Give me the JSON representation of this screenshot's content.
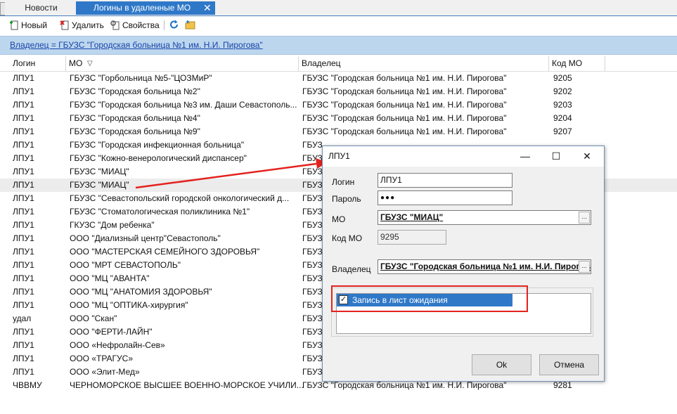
{
  "tabs": [
    {
      "label": "Новости",
      "active": false
    },
    {
      "label": "Логины в удаленные МО",
      "active": true,
      "close": "✕"
    }
  ],
  "toolbar": {
    "new_label": "Новый",
    "delete_label": "Удалить",
    "properties_label": "Свойства",
    "new_icon": "new-doc-icon",
    "delete_icon": "delete-doc-icon",
    "properties_icon": "properties-icon",
    "refresh_icon": "refresh-icon",
    "folder_icon": "folder-icon"
  },
  "filter": {
    "text": "Владелец = ГБУЗС \"Городская больница №1 им. Н.И. Пирогова\""
  },
  "grid": {
    "columns": [
      "Логин",
      "МО",
      "Владелец",
      "Код МО"
    ],
    "rows": [
      [
        "ЛПУ1",
        "ГБУЗС \"Горбольница №5-\"ЦОЗМиР\"",
        "ГБУЗС \"Городская больница №1 им. Н.И. Пирогова\"",
        "9205"
      ],
      [
        "ЛПУ1",
        "ГБУЗС \"Городская больница №2\"",
        "ГБУЗС \"Городская больница №1 им. Н.И. Пирогова\"",
        "9202"
      ],
      [
        "ЛПУ1",
        "ГБУЗС \"Городская больница №3 им. Даши Севастополь...",
        "ГБУЗС \"Городская больница №1 им. Н.И. Пирогова\"",
        "9203"
      ],
      [
        "ЛПУ1",
        "ГБУЗС \"Городская больница №4\"",
        "ГБУЗС \"Городская больница №1 им. Н.И. Пирогова\"",
        "9204"
      ],
      [
        "ЛПУ1",
        "ГБУЗС \"Городская больница №9\"",
        "ГБУЗС \"Городская больница №1 им. Н.И. Пирогова\"",
        "9207"
      ],
      [
        "ЛПУ1",
        "ГБУЗС \"Городская инфекционная больница\"",
        "ГБУЗ",
        ""
      ],
      [
        "ЛПУ1",
        "ГБУЗС \"Кожно-венерологический диспансер\"",
        "ГБУЗ",
        ""
      ],
      [
        "ЛПУ1",
        "ГБУЗС \"МИАЦ\"",
        "ГБУЗ",
        ""
      ],
      [
        "ЛПУ1",
        "ГБУЗС \"МИАЦ\"",
        "ГБУЗ",
        ""
      ],
      [
        "ЛПУ1",
        "ГБУЗС \"Севастопольский городской онкологический д...",
        "ГБУЗ",
        ""
      ],
      [
        "ЛПУ1",
        "ГБУЗС \"Стоматологическая поликлиника №1\"",
        "ГБУЗ",
        ""
      ],
      [
        "ЛПУ1",
        "ГКУЗС \"Дом ребенка\"",
        "ГБУЗ",
        ""
      ],
      [
        "ЛПУ1",
        "ООО \"Диализный центр\"Севастополь\"",
        "ГБУЗ",
        ""
      ],
      [
        "ЛПУ1",
        "ООО \"МАСТЕРСКАЯ СЕМЕЙНОГО ЗДОРОВЬЯ\"",
        "ГБУЗ",
        ""
      ],
      [
        "ЛПУ1",
        "ООО \"МРТ СЕВАСТОПОЛЬ\"",
        "ГБУЗ",
        ""
      ],
      [
        "ЛПУ1",
        "ООО \"МЦ \"АВАНТА\"",
        "ГБУЗ",
        ""
      ],
      [
        "ЛПУ1",
        "ООО \"МЦ \"АНАТОМИЯ ЗДОРОВЬЯ\"",
        "ГБУЗ",
        ""
      ],
      [
        "ЛПУ1",
        "ООО \"МЦ \"ОПТИКА-хирургия\"",
        "ГБУЗ",
        ""
      ],
      [
        "удал",
        "ООО \"Скан\"",
        "ГБУЗ",
        ""
      ],
      [
        "ЛПУ1",
        "ООО \"ФЕРТИ-ЛАЙН\"",
        "ГБУЗ",
        ""
      ],
      [
        "ЛПУ1",
        "ООО «Нефролайн-Сев»",
        "ГБУЗ",
        ""
      ],
      [
        "ЛПУ1",
        "ООО «ТРАГУС»",
        "ГБУЗ",
        ""
      ],
      [
        "ЛПУ1",
        "ООО «Элит-Мед»",
        "ГБУЗ",
        ""
      ],
      [
        "ЧВВМУ",
        "ЧЕРНОМОРСКОЕ ВЫСШЕЕ ВОЕННО-МОРСКОЕ УЧИЛИ...",
        "ГБУЗС \"Городская больница №1 им. Н.И. Пирогова\"",
        "9281"
      ]
    ]
  },
  "dialog": {
    "title": "ЛПУ1",
    "minimize": "—",
    "maximize": "☐",
    "close": "✕",
    "login_label": "Логин",
    "login_value": "ЛПУ1",
    "password_label": "Пароль",
    "password_value": "●●●",
    "mo_label": "МО",
    "mo_value": "ГБУЗС \"МИАЦ\"",
    "kod_label": "Код МО",
    "kod_value": "9295",
    "owner_label": "Владелец",
    "owner_value": "ГБУЗС \"Городская больница №1 им. Н.И. Пирогова\"",
    "ellipsis": "...",
    "checkbox_label": "Запись в лист ожидания",
    "checkbox_checked": true,
    "ok_label": "Ok",
    "cancel_label": "Отмена"
  },
  "annotation_color": "#e3231e"
}
